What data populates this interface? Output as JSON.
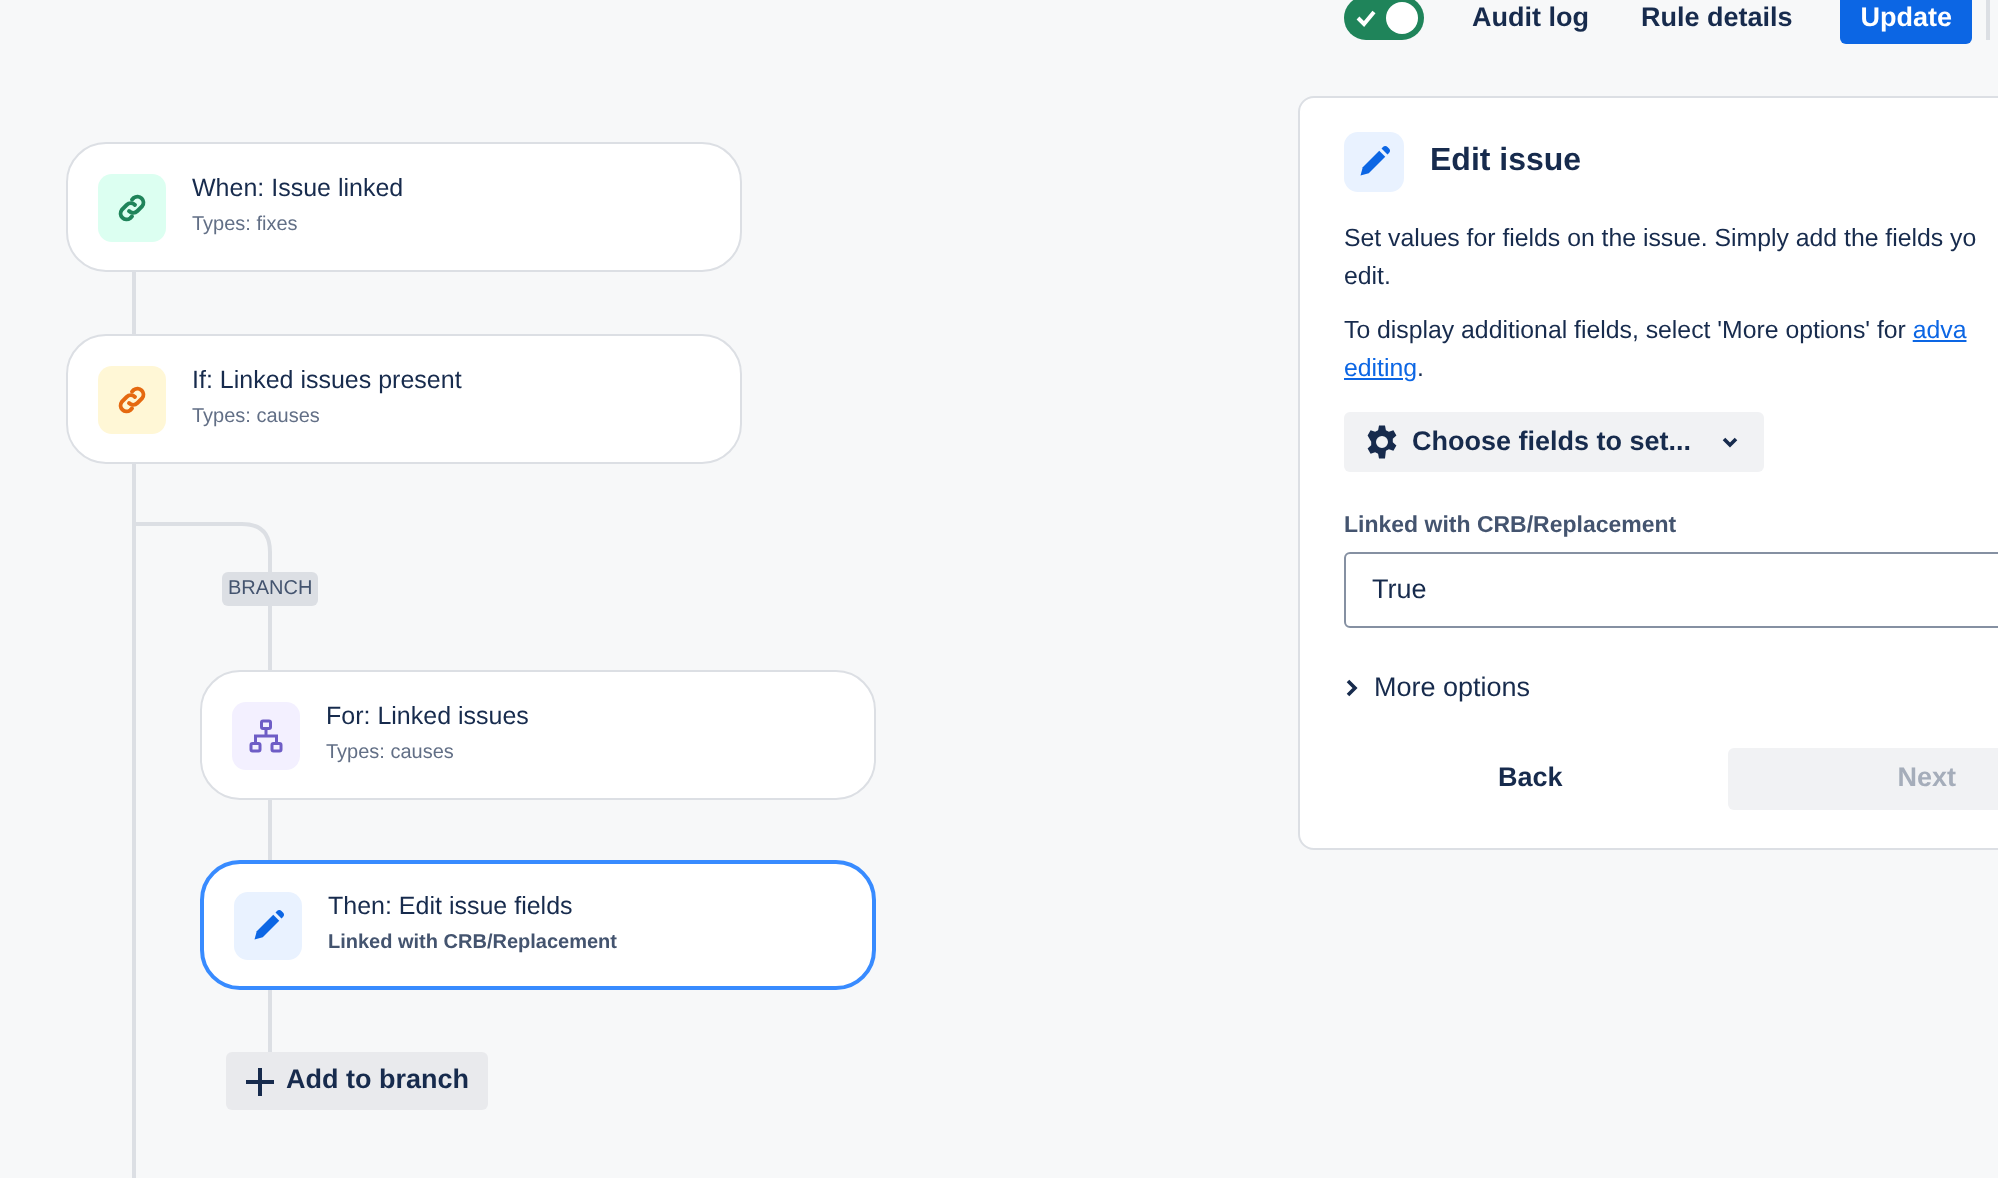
{
  "toolbar": {
    "enabled_toggle": {
      "on": true
    },
    "links": [
      "Audit log",
      "Rule details"
    ],
    "update_button": "Update"
  },
  "flow": {
    "nodes": [
      {
        "kind": "trigger",
        "title": "When: Issue linked",
        "subtitle": "Types: fixes",
        "selected": false
      },
      {
        "kind": "condition",
        "title": "If: Linked issues present",
        "subtitle": "Types: causes",
        "selected": false
      }
    ],
    "branch": {
      "tag": "BRANCH",
      "nodes": [
        {
          "kind": "branch",
          "title": "For: Linked issues",
          "subtitle": "Types: causes",
          "selected": false
        },
        {
          "kind": "action",
          "title": "Then: Edit issue fields",
          "subtitle": "Linked with CRB/Replacement",
          "selected": true
        }
      ],
      "add_button": "Add to branch"
    }
  },
  "panel": {
    "title": "Edit issue",
    "description_lines": [
      "Set values for fields on the issue. Simply add the fields yo",
      "edit."
    ],
    "advanced": {
      "text": "To display additional fields, select 'More options' for",
      "link_lines": [
        "adva",
        "editing"
      ],
      "after": "."
    },
    "choose_button": "Choose fields to set...",
    "field": {
      "label": "Linked with CRB/Replacement",
      "value": "True"
    },
    "more_options": {
      "label": "More options",
      "expanded": false
    },
    "buttons": [
      {
        "label": "Back",
        "disabled": false
      },
      {
        "label": "Next",
        "disabled": true
      }
    ]
  }
}
